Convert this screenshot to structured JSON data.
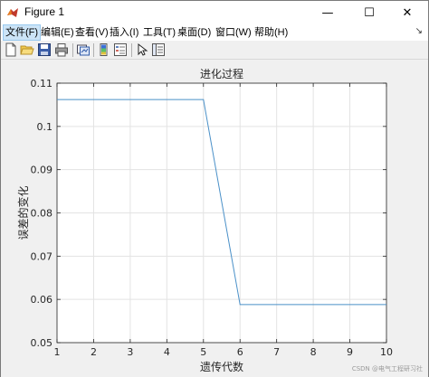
{
  "window": {
    "title": "Figure 1",
    "controls": {
      "minimize": "—",
      "maximize": "☐",
      "close": "✕"
    }
  },
  "menubar": {
    "items": [
      {
        "label": "文件(F)",
        "active": true
      },
      {
        "label": "编辑(E)"
      },
      {
        "label": "查看(V)"
      },
      {
        "label": "插入(I)"
      },
      {
        "label": "工具(T)"
      },
      {
        "label": "桌面(D)"
      },
      {
        "label": "窗口(W)"
      },
      {
        "label": "帮助(H)"
      }
    ],
    "overflow_icon": "dock-arrow-icon"
  },
  "toolbar": {
    "icons": [
      "new-figure-icon",
      "open-file-icon",
      "save-icon",
      "print-icon",
      "link-plot-icon",
      "insert-colorbar-icon",
      "insert-legend-icon",
      "pointer-edit-icon",
      "property-inspector-icon"
    ]
  },
  "chart_data": {
    "type": "line",
    "title": "进化过程",
    "xlabel": "遗传代数",
    "ylabel": "误差的变化",
    "xlim": [
      1,
      10
    ],
    "ylim": [
      0.05,
      0.11
    ],
    "xticks": [
      1,
      2,
      3,
      4,
      5,
      6,
      7,
      8,
      9,
      10
    ],
    "yticks": [
      0.05,
      0.06,
      0.07,
      0.08,
      0.09,
      0.1,
      0.11
    ],
    "ytick_labels": [
      "0.05",
      "0.06",
      "0.07",
      "0.08",
      "0.09",
      "0.1",
      "0.11"
    ],
    "grid": true,
    "color": "#4a90c8",
    "series": [
      {
        "x": [
          1,
          2,
          3,
          4,
          5,
          6,
          7,
          8,
          9,
          10
        ],
        "y": [
          0.1062,
          0.1062,
          0.1062,
          0.1062,
          0.1062,
          0.0588,
          0.0588,
          0.0588,
          0.0588,
          0.0588
        ]
      }
    ]
  },
  "watermark": "CSDN @电气工程研习社"
}
